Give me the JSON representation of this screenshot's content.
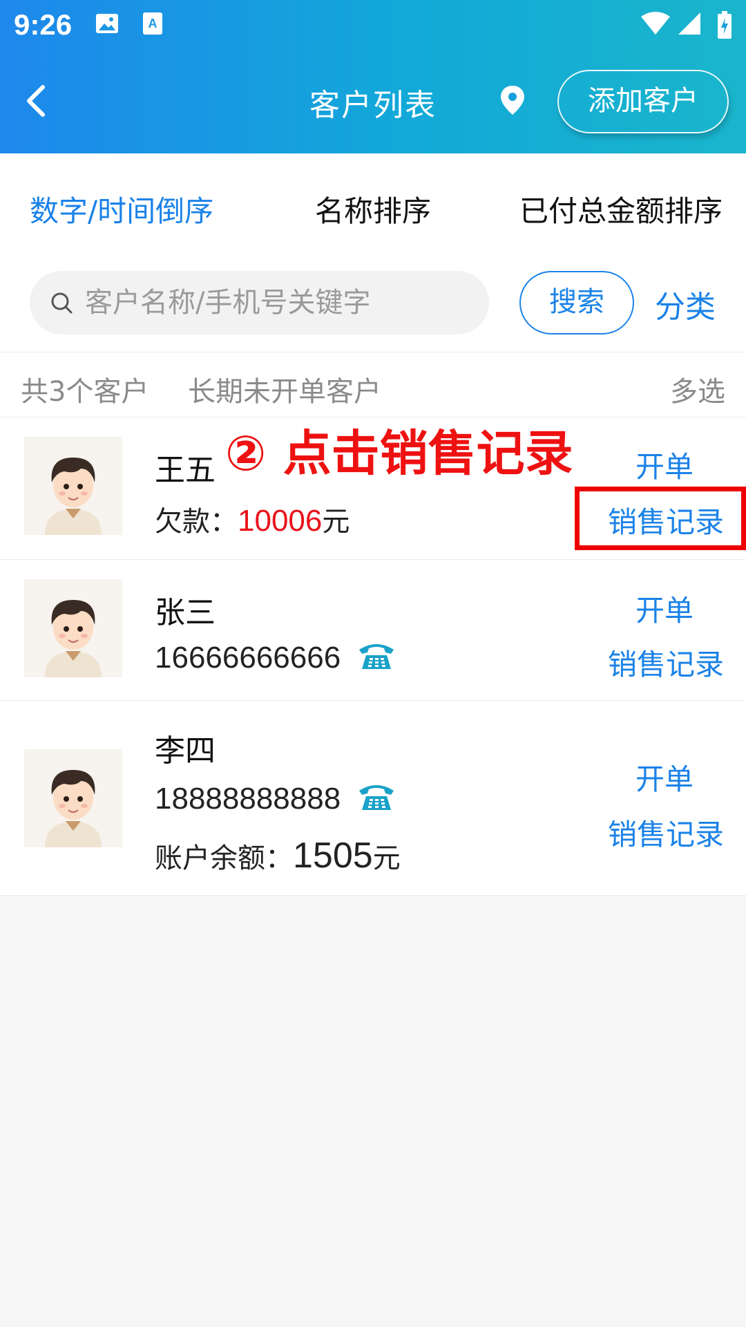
{
  "status_bar": {
    "time": "9:26"
  },
  "header": {
    "title": "客户列表",
    "add_button": "添加客户"
  },
  "sort_tabs": [
    {
      "label": "数字/时间倒序",
      "active": true
    },
    {
      "label": "名称排序",
      "active": false
    },
    {
      "label": "已付总金额排序",
      "active": false
    }
  ],
  "search": {
    "placeholder": "客户名称/手机号关键字",
    "button": "搜索",
    "category": "分类"
  },
  "summary": {
    "count_text": "共3个客户",
    "inactive_text": "长期未开单客户",
    "multi_select": "多选"
  },
  "customers": [
    {
      "name": "王五",
      "debt_label": "欠款：",
      "debt_value": "10006",
      "unit": "元",
      "open_label": "开单",
      "sales_label": "销售记录"
    },
    {
      "name": "张三",
      "phone": "16666666666",
      "open_label": "开单",
      "sales_label": "销售记录"
    },
    {
      "name": "李四",
      "phone": "18888888888",
      "balance_label": "账户余额：",
      "balance_value": "1505",
      "unit": "元",
      "open_label": "开单",
      "sales_label": "销售记录"
    }
  ],
  "annotation": {
    "text": "② 点击销售记录"
  },
  "colors": {
    "accent": "#1a82e8",
    "header_start": "#1e88ec",
    "header_end": "#1ab5cc",
    "debt": "#e8131a",
    "annotation": "#ee1111"
  }
}
